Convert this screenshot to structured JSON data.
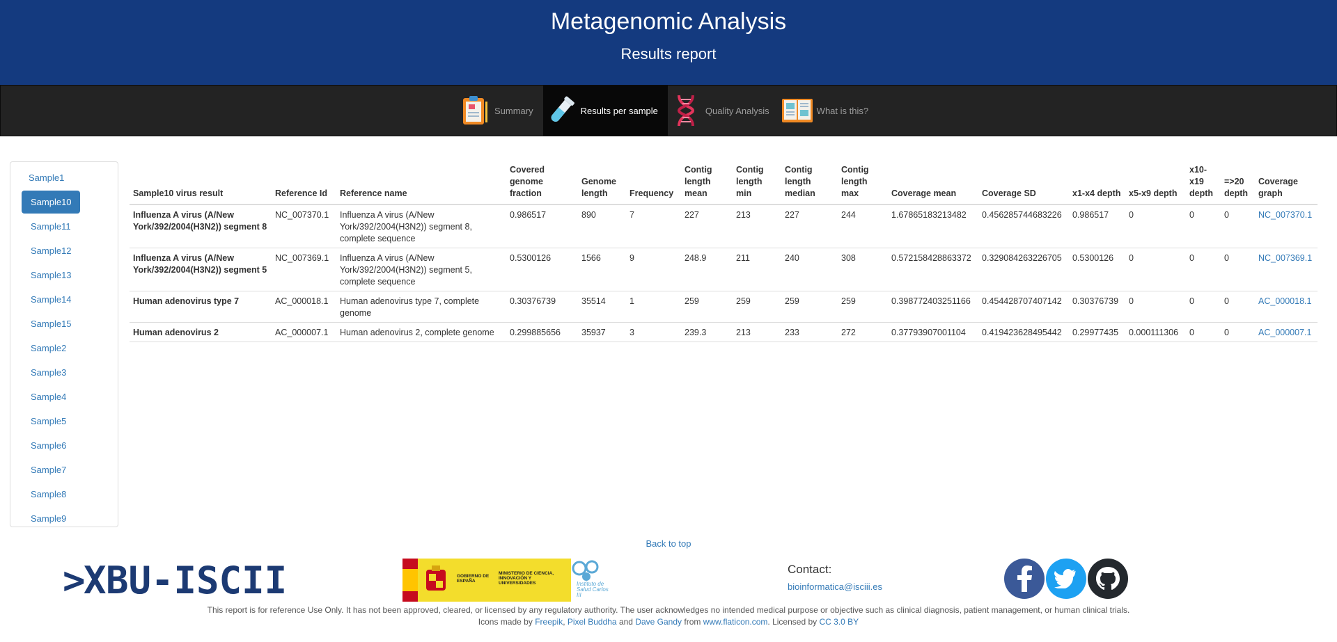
{
  "header": {
    "title": "Metagenomic Analysis",
    "subtitle": "Results report"
  },
  "nav": {
    "items": [
      {
        "label": "Summary",
        "icon": "clipboard-icon"
      },
      {
        "label": "Results per sample",
        "icon": "test-tube-icon",
        "active": true
      },
      {
        "label": "Quality Analysis",
        "icon": "dna-icon"
      },
      {
        "label": "What is this?",
        "icon": "open-book-icon"
      }
    ]
  },
  "sidebar": {
    "items": [
      "Sample1",
      "Sample10",
      "Sample11",
      "Sample12",
      "Sample13",
      "Sample14",
      "Sample15",
      "Sample2",
      "Sample3",
      "Sample4",
      "Sample5",
      "Sample6",
      "Sample7",
      "Sample8",
      "Sample9"
    ],
    "active": "Sample10"
  },
  "table": {
    "headers": {
      "virus": "Sample10 virus result",
      "ref_id": "Reference Id",
      "ref_name": "Reference name",
      "covered": "Covered genome fraction",
      "genome_len": "Genome length",
      "frequency": "Frequency",
      "contig_mean": "Contig length mean",
      "contig_min": "Contig length min",
      "contig_median": "Contig length median",
      "contig_max": "Contig length max",
      "cov_mean": "Coverage mean",
      "cov_sd": "Coverage SD",
      "x1x4": "x1-x4 depth",
      "x5x9": "x5-x9 depth",
      "x10x19": "x10-x19 depth",
      "x20": "=>20 depth",
      "graph": "Coverage graph"
    },
    "rows": [
      {
        "virus": "Influenza A virus (A/New York/392/2004(H3N2)) segment 8",
        "ref_id": "NC_007370.1",
        "ref_name": "Influenza A virus (A/New York/392/2004(H3N2)) segment 8, complete sequence",
        "covered": "0.986517",
        "genome_len": "890",
        "frequency": "7",
        "contig_mean": "227",
        "contig_min": "213",
        "contig_median": "227",
        "contig_max": "244",
        "cov_mean": "1.67865183213482",
        "cov_sd": "0.456285744683226",
        "x1x4": "0.986517",
        "x5x9": "0",
        "x10x19": "0",
        "x20": "0",
        "graph": "NC_007370.1"
      },
      {
        "virus": "Influenza A virus (A/New York/392/2004(H3N2)) segment 5",
        "ref_id": "NC_007369.1",
        "ref_name": "Influenza A virus (A/New York/392/2004(H3N2)) segment 5, complete sequence",
        "covered": "0.5300126",
        "genome_len": "1566",
        "frequency": "9",
        "contig_mean": "248.9",
        "contig_min": "211",
        "contig_median": "240",
        "contig_max": "308",
        "cov_mean": "0.572158428863372",
        "cov_sd": "0.329084263226705",
        "x1x4": "0.5300126",
        "x5x9": "0",
        "x10x19": "0",
        "x20": "0",
        "graph": "NC_007369.1"
      },
      {
        "virus": "Human adenovirus type 7",
        "ref_id": "AC_000018.1",
        "ref_name": "Human adenovirus type 7, complete genome",
        "covered": "0.30376739",
        "genome_len": "35514",
        "frequency": "1",
        "contig_mean": "259",
        "contig_min": "259",
        "contig_median": "259",
        "contig_max": "259",
        "cov_mean": "0.398772403251166",
        "cov_sd": "0.454428707407142",
        "x1x4": "0.30376739",
        "x5x9": "0",
        "x10x19": "0",
        "x20": "0",
        "graph": "AC_000018.1"
      },
      {
        "virus": "Human adenovirus 2",
        "ref_id": "AC_000007.1",
        "ref_name": "Human adenovirus 2, complete genome",
        "covered": "0.299885656",
        "genome_len": "35937",
        "frequency": "3",
        "contig_mean": "239.3",
        "contig_min": "213",
        "contig_median": "233",
        "contig_max": "272",
        "cov_mean": "0.37793907001104",
        "cov_sd": "0.419423628495442",
        "x1x4": "0.29977435",
        "x5x9": "0.000111306",
        "x10x19": "0",
        "x20": "0",
        "graph": "AC_000007.1"
      }
    ]
  },
  "footer": {
    "back_to_top": "Back to top",
    "logo_text": "BU-ISCIII",
    "gov_text_1": "GOBIERNO DE ESPAÑA",
    "gov_text_2": "MINISTERIO DE CIENCIA, INNOVACIÓN Y UNIVERSIDADES",
    "isciii_text": "Instituto de Salud Carlos III",
    "contact_label": "Contact:",
    "contact_email": "bioinformatica@isciii.es",
    "disclaimer": "This report is for reference Use Only. It has not been approved, cleared, or licensed by any regulatory authority. The user acknowledges no intended medical purpose or objective such as clinical diagnosis, patient management, or human clinical trials.",
    "credits": {
      "prefix": "Icons made by",
      "author1": "Freepik",
      "sep1": ",",
      "author2": "Pixel Buddha",
      "and": "and",
      "author3": "Dave Gandy",
      "from": "from",
      "site": "www.flaticon.com",
      "licensed": ". Licensed by",
      "license": "CC 3.0 BY"
    },
    "social": [
      "facebook-icon",
      "twitter-icon",
      "github-icon"
    ]
  },
  "colors": {
    "banner": "#143a7f",
    "navbar": "#232323",
    "link": "#337ab7",
    "active_pill": "#337ab7"
  }
}
